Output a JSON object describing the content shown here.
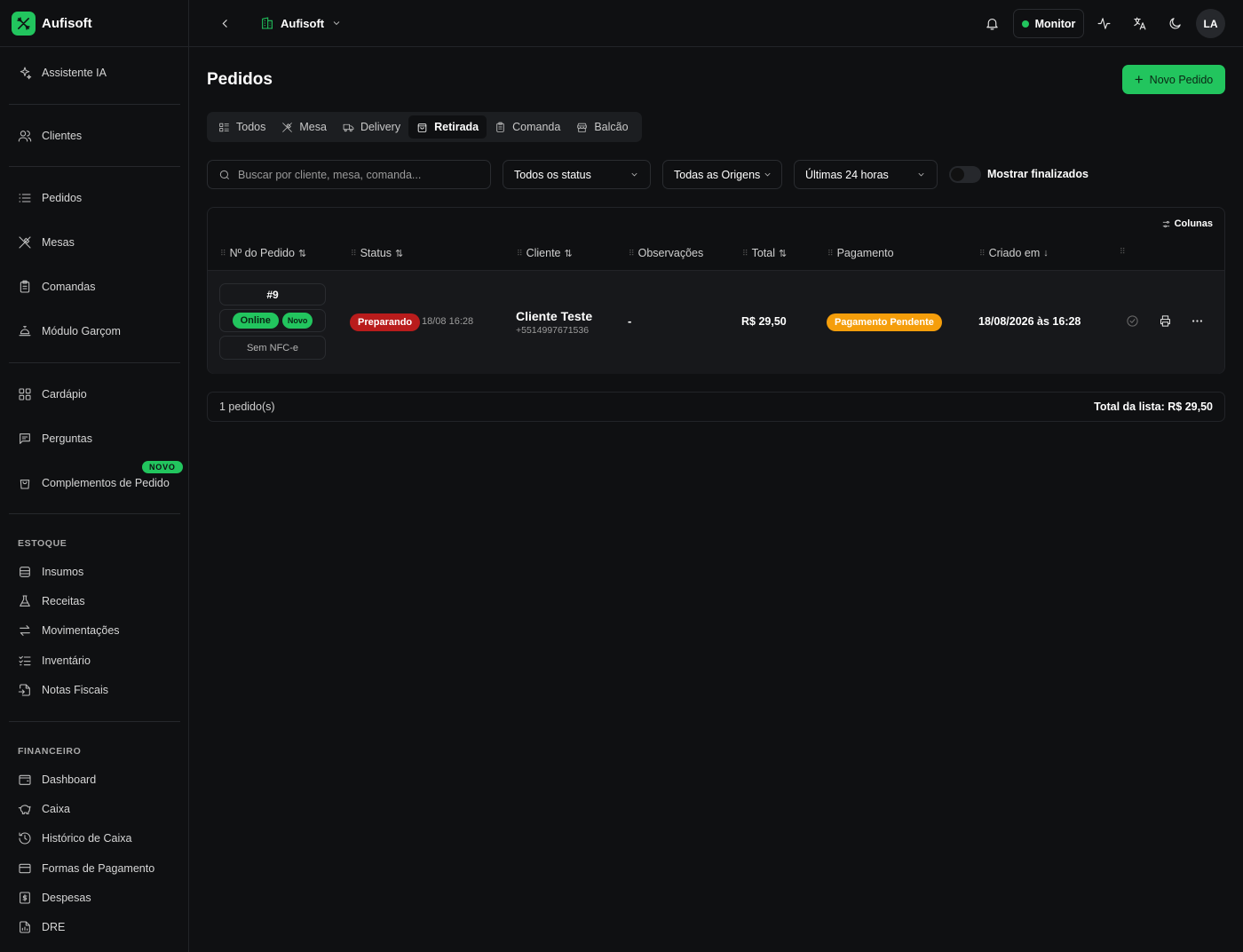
{
  "brand": {
    "name": "Aufisoft"
  },
  "sidebar": {
    "items": [
      {
        "label": "Assistente IA",
        "icon": "sparkles-icon"
      },
      {
        "label": "Clientes",
        "icon": "users-icon"
      },
      {
        "label": "Pedidos",
        "icon": "list-icon"
      },
      {
        "label": "Mesas",
        "icon": "utensils-icon"
      },
      {
        "label": "Comandas",
        "icon": "clipboard-icon"
      },
      {
        "label": "Módulo Garçom",
        "icon": "service-bell-icon"
      },
      {
        "label": "Cardápio",
        "icon": "grid-icon"
      },
      {
        "label": "Perguntas",
        "icon": "message-icon"
      },
      {
        "label": "Complementos de Pedido",
        "icon": "shopping-bag-icon",
        "badge": "NOVO"
      }
    ],
    "estoque_title": "ESTOQUE",
    "estoque": [
      {
        "label": "Insumos",
        "icon": "database-icon"
      },
      {
        "label": "Receitas",
        "icon": "flask-icon"
      },
      {
        "label": "Movimentações",
        "icon": "arrows-icon"
      },
      {
        "label": "Inventário",
        "icon": "checklist-icon"
      },
      {
        "label": "Notas Fiscais",
        "icon": "file-import-icon"
      }
    ],
    "financeiro_title": "FINANCEIRO",
    "financeiro": [
      {
        "label": "Dashboard",
        "icon": "wallet-icon"
      },
      {
        "label": "Caixa",
        "icon": "piggy-bank-icon"
      },
      {
        "label": "Histórico de Caixa",
        "icon": "history-icon"
      },
      {
        "label": "Formas de Pagamento",
        "icon": "credit-card-icon"
      },
      {
        "label": "Despesas",
        "icon": "receipt-icon"
      },
      {
        "label": "DRE",
        "icon": "report-icon"
      }
    ]
  },
  "topbar": {
    "org_name": "Aufisoft",
    "monitor_label": "Monitor",
    "avatar_initials": "LA"
  },
  "page": {
    "title": "Pedidos",
    "new_button": "Novo Pedido"
  },
  "tabs": [
    {
      "label": "Todos",
      "icon": "list-icon"
    },
    {
      "label": "Mesa",
      "icon": "utensils-icon"
    },
    {
      "label": "Delivery",
      "icon": "truck-icon"
    },
    {
      "label": "Retirada",
      "icon": "bag-icon",
      "active": true
    },
    {
      "label": "Comanda",
      "icon": "clipboard-icon"
    },
    {
      "label": "Balcão",
      "icon": "store-icon"
    }
  ],
  "filters": {
    "search_placeholder": "Buscar por cliente, mesa, comanda...",
    "status": "Todos os status",
    "origins": "Todas as Origens",
    "period": "Últimas 24 horas",
    "show_finished": "Mostrar finalizados"
  },
  "table": {
    "columns_button": "Colunas",
    "headers": [
      "Nº do Pedido",
      "Status",
      "Cliente",
      "Observações",
      "Total",
      "Pagamento",
      "Criado em"
    ],
    "rows": [
      {
        "order_no": "#9",
        "origin_tag": "Online",
        "new_tag": "Novo",
        "nfce": "Sem NFC-e",
        "status": "Preparando",
        "status_time": "18/08 16:28",
        "client_name": "Cliente Teste",
        "client_phone": "+5514997671536",
        "observations": "-",
        "total": "R$ 29,50",
        "payment": "Pagamento Pendente",
        "created_at": "18/08/2026 às 16:28"
      }
    ]
  },
  "footer": {
    "count": "1 pedido(s)",
    "sum": "Total da lista: R$ 29,50"
  },
  "colors": {
    "accent": "#22c55e",
    "danger": "#b91c1c",
    "warning": "#f59e0b",
    "background": "#0f1012"
  }
}
